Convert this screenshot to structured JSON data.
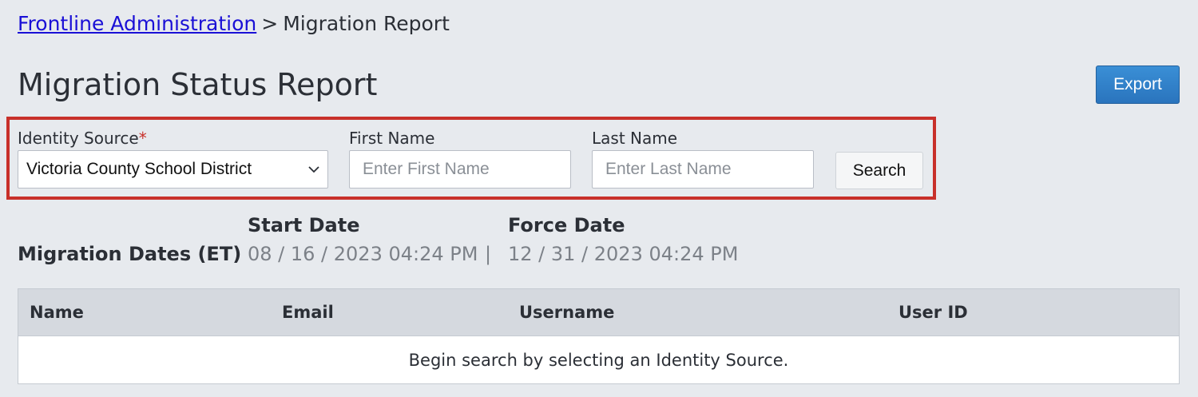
{
  "breadcrumb": {
    "parent_label": "Frontline Administration",
    "separator": ">",
    "current_label": "Migration Report"
  },
  "page_title": "Migration Status Report",
  "toolbar": {
    "export_label": "Export"
  },
  "filters": {
    "identity_source": {
      "label": "Identity Source",
      "required_marker": "*",
      "selected_value": "Victoria County School District",
      "icon": "chevron-down-icon"
    },
    "first_name": {
      "label": "First Name",
      "value": "",
      "placeholder": "Enter First Name"
    },
    "last_name": {
      "label": "Last Name",
      "value": "",
      "placeholder": "Enter Last Name"
    },
    "search_label": "Search"
  },
  "migration_dates": {
    "label": "Migration Dates (ET)",
    "start_heading": "Start Date",
    "start_value": "08 / 16 / 2023 04:24 PM",
    "separator": "|",
    "force_heading": "Force Date",
    "force_value": "12 / 31 / 2023 04:24 PM"
  },
  "table": {
    "columns": [
      "Name",
      "Email",
      "Username",
      "User ID"
    ],
    "empty_message": "Begin search by selecting an Identity Source."
  },
  "colors": {
    "background": "#e7eaee",
    "link": "#1a10d6",
    "primary_button": "#2f80c9",
    "highlight_border": "#c8302a",
    "required": "#c8302a",
    "muted_text": "#7c8188",
    "table_header": "#d5d9df"
  }
}
